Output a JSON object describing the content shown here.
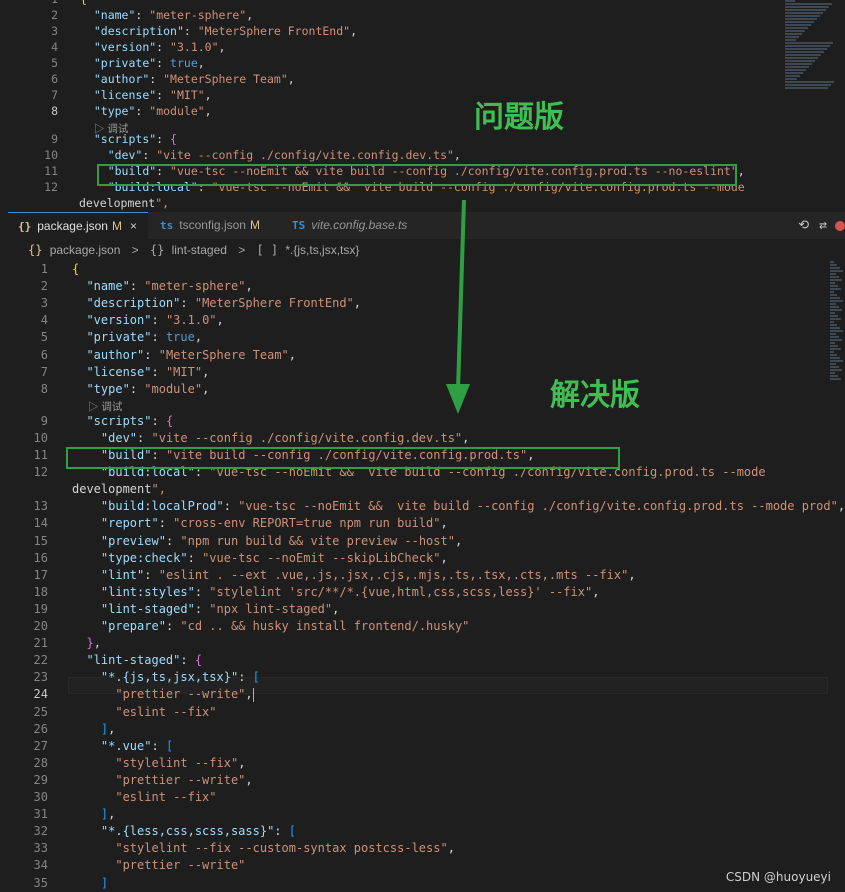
{
  "annotations": {
    "problem_label": "问题版",
    "solution_label": "解决版"
  },
  "colors": {
    "highlight_green": "#2ea043",
    "annotation_green": "#3fbf52",
    "editor_bg": "#1e1e1e"
  },
  "top_editor": {
    "codelens": "调试",
    "lines": [
      {
        "num": "1",
        "code": "{"
      },
      {
        "num": "2",
        "code": "  \"name\": \"meter-sphere\","
      },
      {
        "num": "3",
        "code": "  \"description\": \"MeterSphere FrontEnd\","
      },
      {
        "num": "4",
        "code": "  \"version\": \"3.1.0\","
      },
      {
        "num": "5",
        "code": "  \"private\": true,"
      },
      {
        "num": "6",
        "code": "  \"author\": \"MeterSphere Team\","
      },
      {
        "num": "7",
        "code": "  \"license\": \"MIT\","
      },
      {
        "num": "8",
        "code": "  \"type\": \"module\","
      },
      {
        "num": "9",
        "code": "  \"scripts\": {"
      },
      {
        "num": "10",
        "code": "    \"dev\": \"vite --config ./config/vite.config.dev.ts\","
      },
      {
        "num": "11",
        "code": "    \"build\": \"vue-tsc --noEmit && vite build --config ./config/vite.config.prod.ts --no-eslint\","
      },
      {
        "num": "12",
        "code": "    \"build:local\": \"vue-tsc --noEmit &&  vite build --config ./config/vite.config.prod.ts --mode"
      },
      {
        "num": "",
        "code": "development\","
      }
    ]
  },
  "tabs": [
    {
      "icon": "{}",
      "label": "package.json",
      "modified": "M",
      "close": "×",
      "active": true
    },
    {
      "icon": "ts",
      "label": "tsconfig.json",
      "modified": "M",
      "close": "",
      "active": false
    },
    {
      "icon": "TS",
      "label": "vite.config.base.ts",
      "modified": "",
      "close": "",
      "active": false
    }
  ],
  "breadcrumb": {
    "file_icon": "{}",
    "file": "package.json",
    "sep": ">",
    "node_icon": "{}",
    "node": "lint-staged",
    "array_icon": "[ ]",
    "leaf": "*.{js,ts,jsx,tsx}"
  },
  "bottom_editor": {
    "codelens": "调试",
    "lines": [
      {
        "num": "1",
        "code": "{"
      },
      {
        "num": "2",
        "code": "  \"name\": \"meter-sphere\","
      },
      {
        "num": "3",
        "code": "  \"description\": \"MeterSphere FrontEnd\","
      },
      {
        "num": "4",
        "code": "  \"version\": \"3.1.0\","
      },
      {
        "num": "5",
        "code": "  \"private\": true,"
      },
      {
        "num": "6",
        "code": "  \"author\": \"MeterSphere Team\","
      },
      {
        "num": "7",
        "code": "  \"license\": \"MIT\","
      },
      {
        "num": "8",
        "code": "  \"type\": \"module\","
      },
      {
        "num": "9",
        "code": "  \"scripts\": {"
      },
      {
        "num": "10",
        "code": "    \"dev\": \"vite --config ./config/vite.config.dev.ts\","
      },
      {
        "num": "11",
        "code": "    \"build\": \"vite build --config ./config/vite.config.prod.ts\","
      },
      {
        "num": "12",
        "code": "    \"build:local\": \"vue-tsc --noEmit &&  vite build --config ./config/vite.config.prod.ts --mode"
      },
      {
        "num": "",
        "code": "development\","
      },
      {
        "num": "13",
        "code": "    \"build:localProd\": \"vue-tsc --noEmit &&  vite build --config ./config/vite.config.prod.ts --mode prod\","
      },
      {
        "num": "14",
        "code": "    \"report\": \"cross-env REPORT=true npm run build\","
      },
      {
        "num": "15",
        "code": "    \"preview\": \"npm run build && vite preview --host\","
      },
      {
        "num": "16",
        "code": "    \"type:check\": \"vue-tsc --noEmit --skipLibCheck\","
      },
      {
        "num": "17",
        "code": "    \"lint\": \"eslint . --ext .vue,.js,.jsx,.cjs,.mjs,.ts,.tsx,.cts,.mts --fix\","
      },
      {
        "num": "18",
        "code": "    \"lint:styles\": \"stylelint 'src/**/*.{vue,html,css,scss,less}' --fix\","
      },
      {
        "num": "19",
        "code": "    \"lint-staged\": \"npx lint-staged\","
      },
      {
        "num": "20",
        "code": "    \"prepare\": \"cd .. && husky install frontend/.husky\""
      },
      {
        "num": "21",
        "code": "  },"
      },
      {
        "num": "22",
        "code": "  \"lint-staged\": {"
      },
      {
        "num": "23",
        "code": "    \"*.{js,ts,jsx,tsx}\": ["
      },
      {
        "num": "24",
        "code": "      \"prettier --write\","
      },
      {
        "num": "25",
        "code": "      \"eslint --fix\""
      },
      {
        "num": "26",
        "code": "    ],"
      },
      {
        "num": "27",
        "code": "    \"*.vue\": ["
      },
      {
        "num": "28",
        "code": "      \"stylelint --fix\","
      },
      {
        "num": "29",
        "code": "      \"prettier --write\","
      },
      {
        "num": "30",
        "code": "      \"eslint --fix\""
      },
      {
        "num": "31",
        "code": "    ],"
      },
      {
        "num": "32",
        "code": "    \"*.{less,css,scss,sass}\": ["
      },
      {
        "num": "33",
        "code": "      \"stylelint --fix --custom-syntax postcss-less\","
      },
      {
        "num": "34",
        "code": "      \"prettier --write\""
      },
      {
        "num": "35",
        "code": "    ]"
      }
    ]
  },
  "watermark": "CSDN @huoyueyi"
}
